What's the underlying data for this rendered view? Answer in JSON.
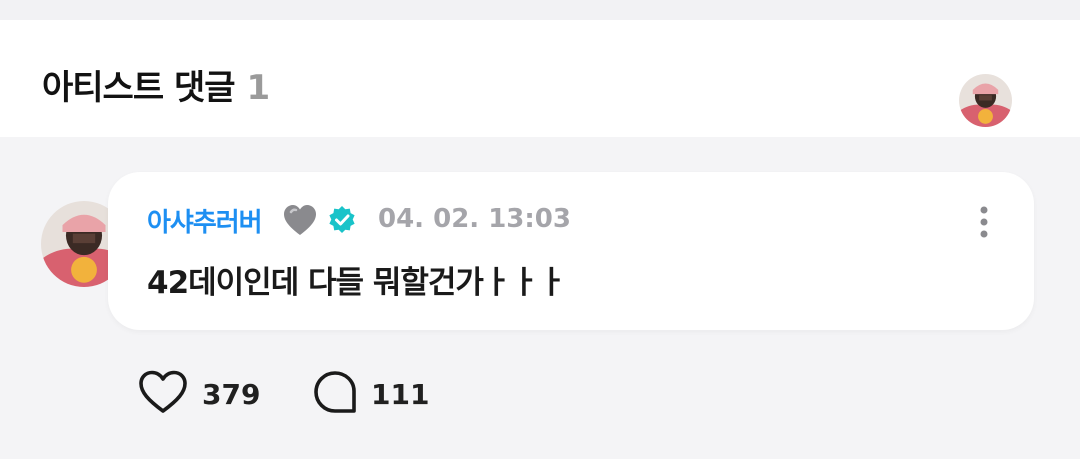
{
  "header": {
    "title": "아티스트 댓글",
    "count": "1"
  },
  "comment": {
    "author": "아샤추러버",
    "author_emoji": "grey-heart",
    "verified": true,
    "timestamp": "04. 02. 13:03",
    "text": "42데이인데 다들 뭐할건가ㅏㅏㅏ"
  },
  "actions": {
    "likes": "379",
    "replies": "111"
  },
  "colors": {
    "author": "#1d8ff2",
    "verified_badge": "#19c3c9",
    "timestamp": "#a5a5aa",
    "count_muted": "#9a9a9a",
    "background": "#f4f4f6",
    "card": "#ffffff"
  }
}
